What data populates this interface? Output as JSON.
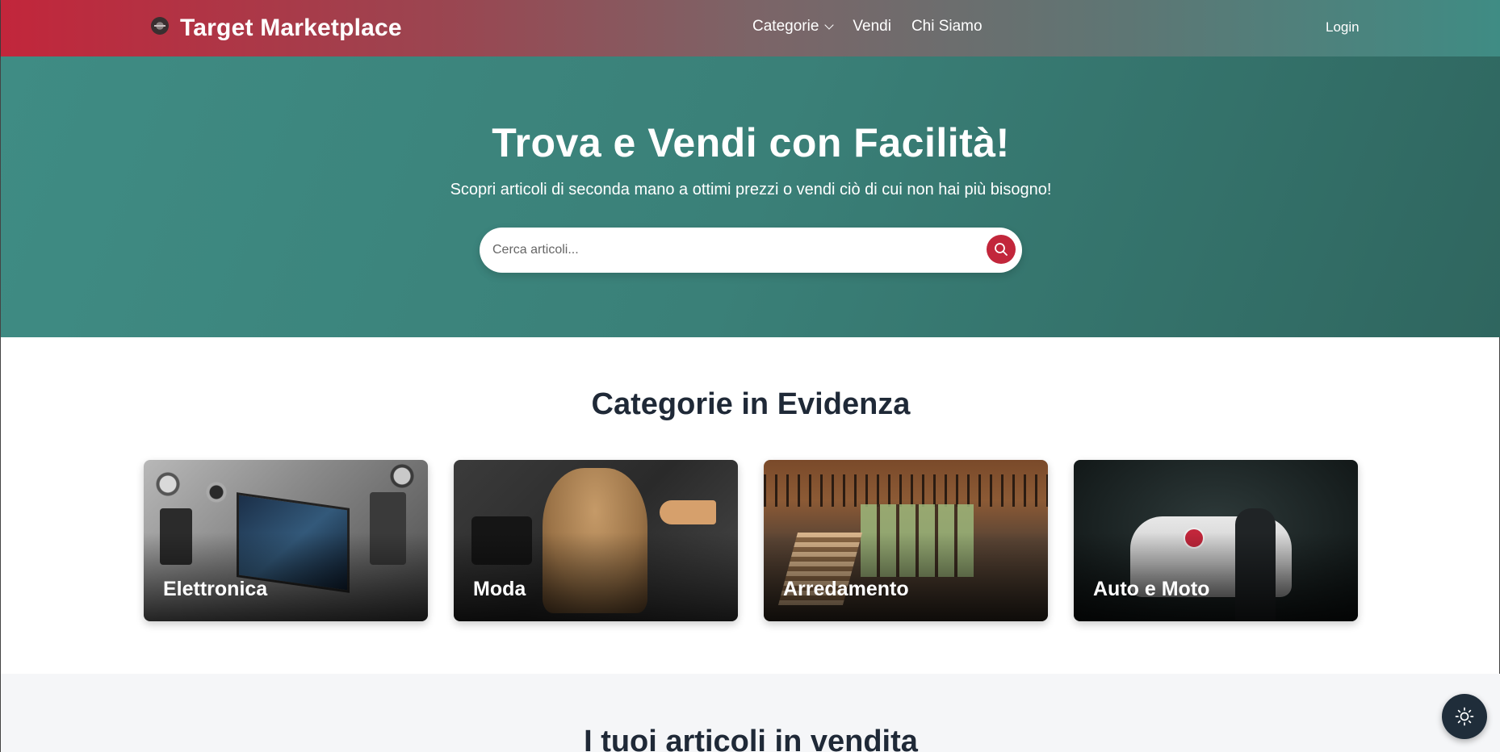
{
  "navbar": {
    "brand": "Target Marketplace",
    "links": [
      {
        "label": "Categorie",
        "has_dropdown": true
      },
      {
        "label": "Vendi"
      },
      {
        "label": "Chi Siamo"
      }
    ],
    "login": "Login"
  },
  "hero": {
    "title": "Trova e Vendi con Facilità!",
    "subtitle": "Scopri articoli di seconda mano a ottimi prezzi o vendi ciò di cui non hai più bisogno!",
    "search_placeholder": "Cerca articoli...",
    "search_value": ""
  },
  "categories": {
    "title": "Categorie in Evidenza",
    "items": [
      {
        "label": "Elettronica"
      },
      {
        "label": "Moda"
      },
      {
        "label": "Arredamento"
      },
      {
        "label": "Auto e Moto"
      }
    ]
  },
  "items_section": {
    "title": "I tuoi articoli in vendita"
  },
  "icons": {
    "brand": "logo-icon",
    "search": "search-icon",
    "dropdown": "chevron-down-icon",
    "theme": "sun-icon"
  },
  "colors": {
    "accent_red": "#c2263b",
    "teal": "#3f8c84",
    "dark_text": "#1f2937",
    "toggle_bg": "#1f2d3a"
  }
}
